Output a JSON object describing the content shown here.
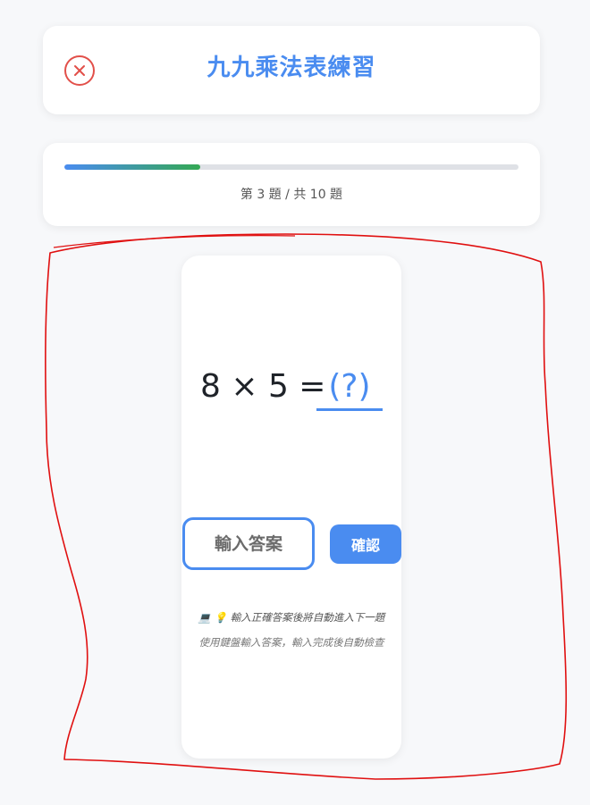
{
  "header": {
    "title": "九九乘法表練習",
    "close_icon": "close-icon"
  },
  "progress": {
    "current": 3,
    "total": 10,
    "fraction": 0.3,
    "text": "第 3 題 / 共 10 題",
    "colors": {
      "start": "#4a8cf0",
      "end": "#34a853",
      "track": "#dfe1e6"
    }
  },
  "question": {
    "equation": "8 × 5 =",
    "answer_placeholder": "(?)"
  },
  "input": {
    "placeholder": "輸入答案"
  },
  "buttons": {
    "confirm_label": "確認"
  },
  "hints": {
    "line1": "💻 💡 輸入正確答案後將自動進入下一題",
    "line2": "使用鍵盤輸入答案，輸入完成後自動檢查"
  },
  "colors": {
    "accent": "#4a8cf0",
    "close": "#e2504a",
    "annotation": "#e01010"
  }
}
